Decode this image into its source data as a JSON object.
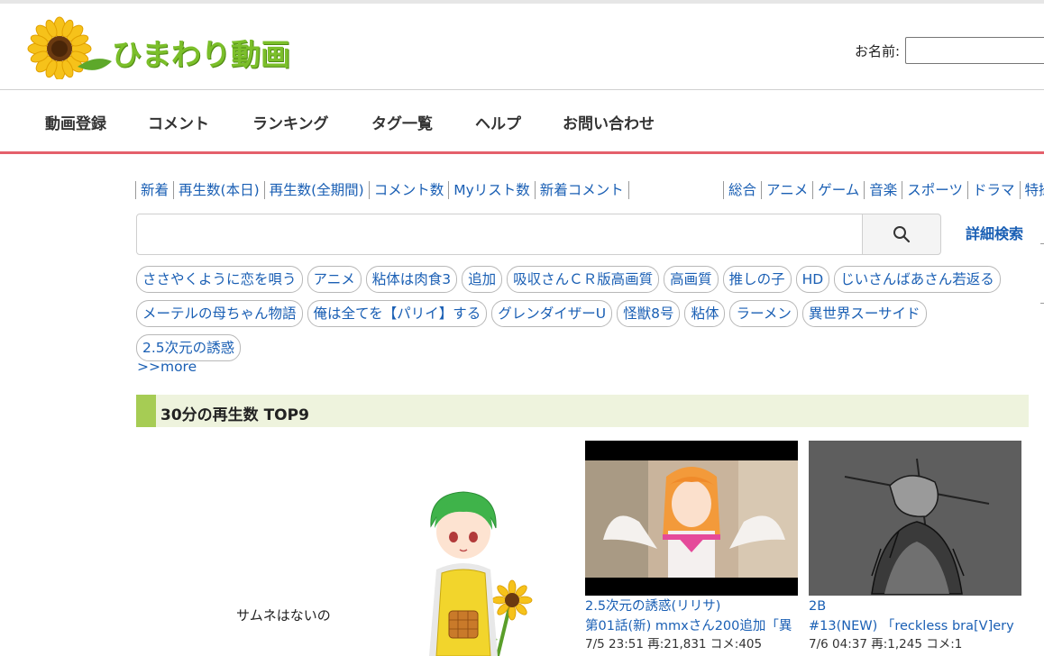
{
  "header": {
    "logo_text": "ひまわり動画",
    "name_label": "お名前:",
    "name_value": ""
  },
  "nav": {
    "items": [
      "動画登録",
      "コメント",
      "ランキング",
      "タグ一覧",
      "ヘルプ",
      "お問い合わせ"
    ]
  },
  "sort_links": [
    "新着",
    "再生数(本日)",
    "再生数(全期間)",
    "コメント数",
    "Myリスト数",
    "新着コメント"
  ],
  "category_links": [
    "総合",
    "アニメ",
    "ゲーム",
    "音楽",
    "スポーツ",
    "ドラマ",
    "特撮"
  ],
  "search": {
    "value": "",
    "advanced_label": "詳細検索"
  },
  "tags": {
    "row1": [
      "ささやくように恋を唄う",
      "アニメ",
      "粘体は肉食3",
      "追加",
      "吸収さんＣＲ版高画質",
      "高画質",
      "推しの子",
      "HD",
      "じいさんばあさん若返る"
    ],
    "row2": [
      "メーテルの母ちゃん物語",
      "俺は全てを【パリイ】する",
      "グレンダイザーU",
      "怪獣8号",
      "粘体",
      "ラーメン",
      "異世界スーサイド"
    ],
    "row3": [
      "2.5次元の誘惑"
    ],
    "more_label": ">>more"
  },
  "section": {
    "title": "30分の再生数 TOP9"
  },
  "no_thumb_text": "サムネはないの",
  "videos": [
    {
      "line1": "2.5次元の誘惑(リリサ)",
      "line2": "第01話(新) mmxさん200追加「異",
      "meta": "7/5 23:51 再:21,831 コメ:405"
    },
    {
      "line1": "2B",
      "line2": "#13(NEW) 「reckless bra[V]ery",
      "meta": "7/6 04:37 再:1,245 コメ:1"
    }
  ],
  "colors": {
    "accent_red": "#e4606b",
    "link_blue": "#1a5fb4",
    "section_green": "#a6cc54",
    "section_bg": "#eef3dd",
    "logo_green": "#7bbf2a"
  }
}
